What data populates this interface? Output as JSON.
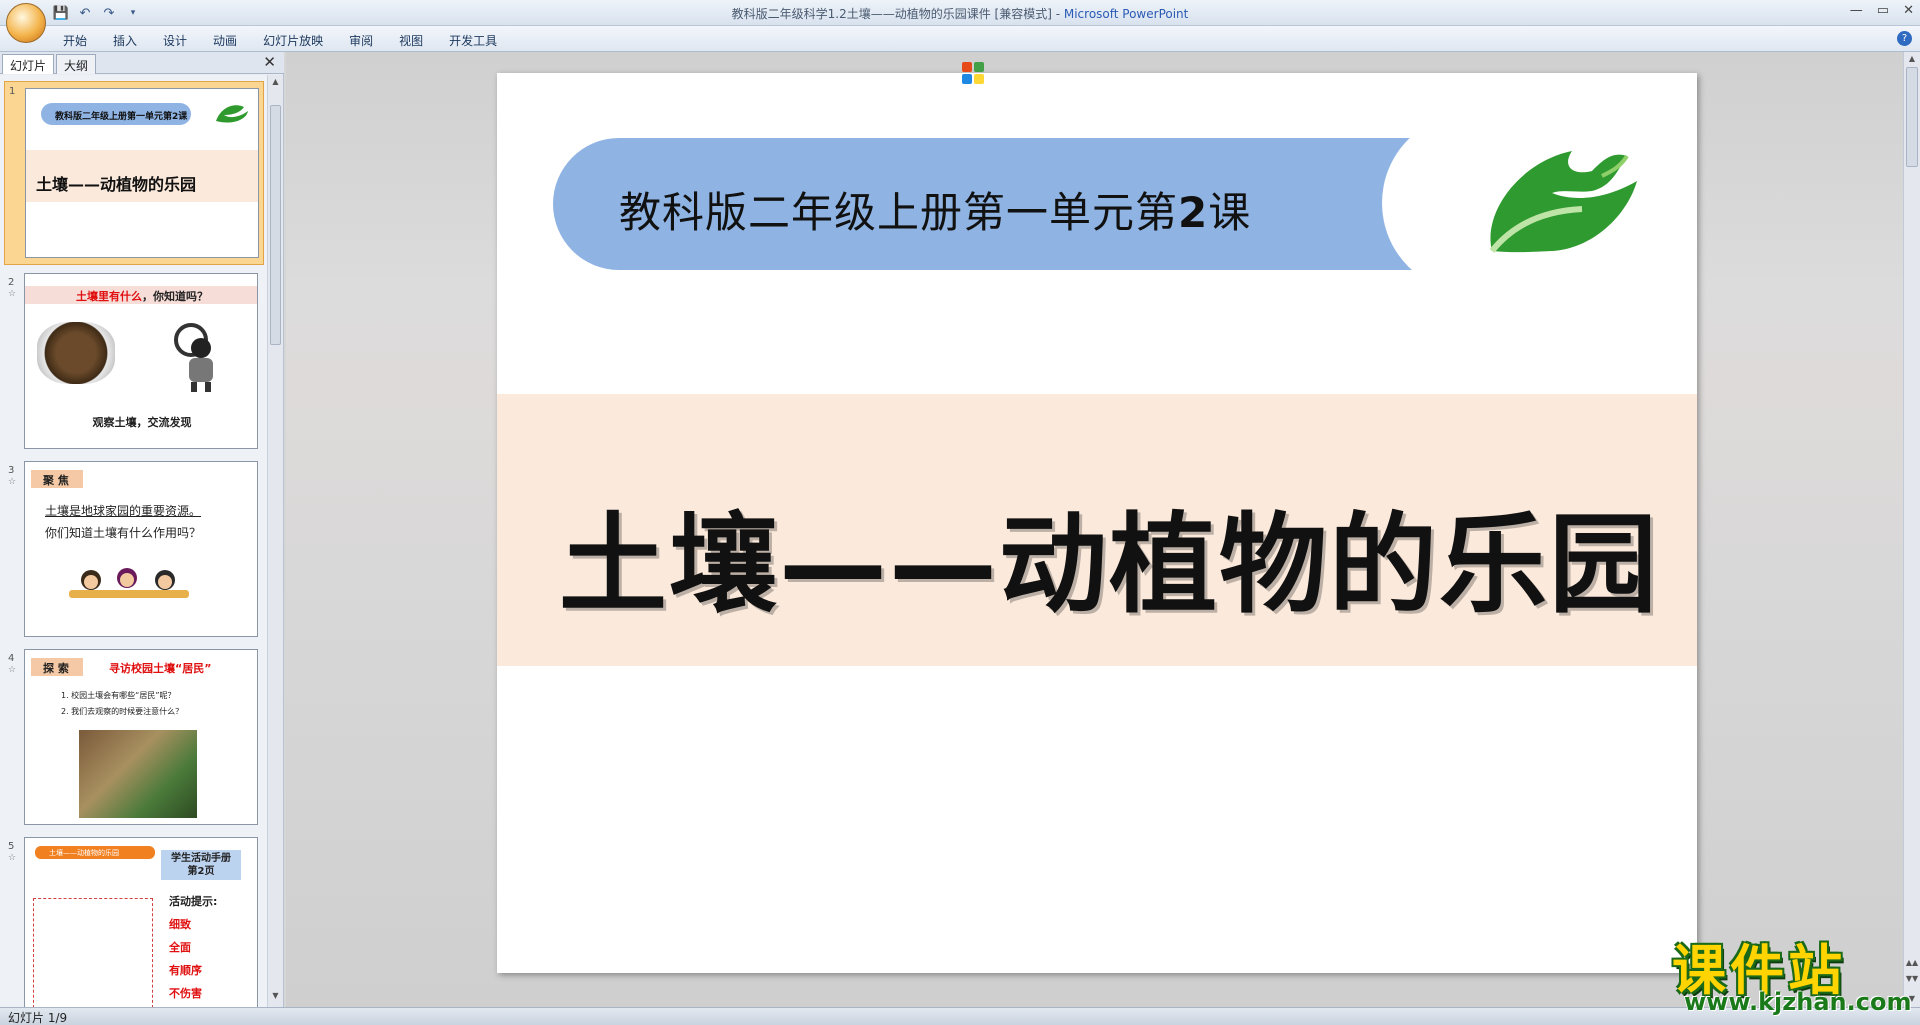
{
  "window": {
    "title_doc": "教科版二年级科学1.2土壤——动植物的乐园课件 [兼容模式] - ",
    "title_app": "Microsoft PowerPoint"
  },
  "ribbon": {
    "tabs": [
      "开始",
      "插入",
      "设计",
      "动画",
      "幻灯片放映",
      "审阅",
      "视图",
      "开发工具"
    ]
  },
  "pane": {
    "tabs": [
      "幻灯片",
      "大纲"
    ]
  },
  "thumbs": {
    "s1": {
      "num": "1",
      "pill": "教科版二年级上册第一单元第2课",
      "title": "土壤——动植物的乐园"
    },
    "s2": {
      "num": "2",
      "head_red": "土壤里有什么",
      "head_rest": "，你知道吗？",
      "caption": "观察土壤，交流发现"
    },
    "s3": {
      "num": "3",
      "tag": "聚 焦",
      "line1": "土壤是地球家园的重要资源。",
      "line2": "你们知道土壤有什么作用吗？"
    },
    "s4": {
      "num": "4",
      "tag": "探 索",
      "title": "寻访校园土壤“居民”",
      "q1": "1. 校园土壤会有哪些“居民”呢？",
      "q2": "2. 我们去观察的时候要注意什么？"
    },
    "s5": {
      "num": "5",
      "banner": "土壤——动植物的乐园",
      "box1": "学生活动手册",
      "box2": "第2页",
      "tip": "活动提示:",
      "words": [
        "细致",
        "全面",
        "有顺序",
        "不伤害"
      ]
    }
  },
  "slide": {
    "header_prefix": "教科版二年级上册第一单元第",
    "header_num": "2",
    "header_suffix": "课",
    "title": "土壤——动植物的乐园"
  },
  "status": {
    "text": "幻灯片 1/9"
  },
  "watermark": {
    "cn": "课件站",
    "url": "www.kjzhan.com"
  },
  "colors": {
    "pill": "#8fb4e3",
    "band": "#fbeadc",
    "accent_red": "#e01010",
    "selected_thumb": "#fbd692"
  }
}
